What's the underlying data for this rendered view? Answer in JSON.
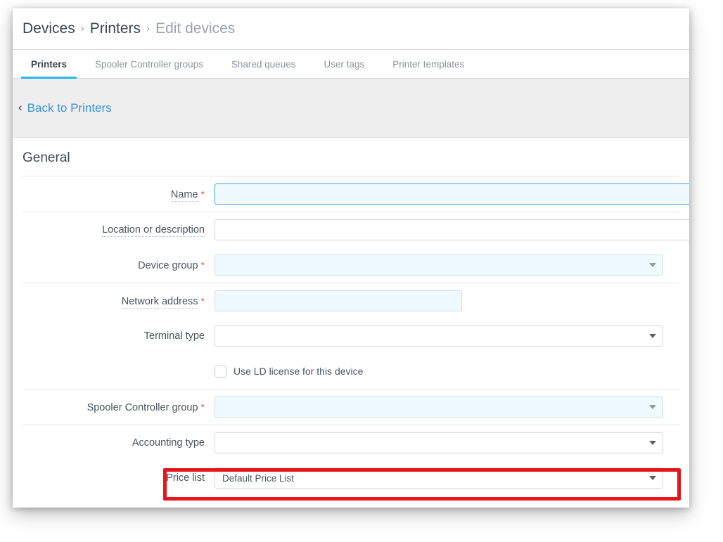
{
  "breadcrumb": {
    "items": [
      {
        "label": "Devices",
        "current": false
      },
      {
        "label": "Printers",
        "current": false
      },
      {
        "label": "Edit devices",
        "current": true
      }
    ],
    "separator": "›"
  },
  "tabs": [
    {
      "label": "Printers",
      "active": true
    },
    {
      "label": "Spooler Controller groups",
      "active": false
    },
    {
      "label": "Shared queues",
      "active": false
    },
    {
      "label": "User tags",
      "active": false
    },
    {
      "label": "Printer templates",
      "active": false
    }
  ],
  "back_link": {
    "label": "Back to Printers",
    "icon": "chevron-left-icon",
    "chevron": "‹"
  },
  "section": {
    "title": "General"
  },
  "fields": {
    "name": {
      "label": "Name",
      "required": true,
      "required_mark": "*",
      "value": "",
      "placeholder": ""
    },
    "location": {
      "label": "Location or description",
      "required": false,
      "value": "",
      "placeholder": ""
    },
    "device_group": {
      "label": "Device group",
      "required": true,
      "required_mark": "*",
      "value": ""
    },
    "network_address": {
      "label": "Network address",
      "required": true,
      "required_mark": "*",
      "value": "",
      "placeholder": ""
    },
    "terminal_type": {
      "label": "Terminal type",
      "required": false,
      "value": ""
    },
    "ld_license": {
      "label": "Use LD license for this device",
      "checked": false
    },
    "spooler_controller_group": {
      "label": "Spooler Controller group",
      "required": true,
      "required_mark": "*",
      "value": ""
    },
    "accounting_type": {
      "label": "Accounting type",
      "required": false,
      "value": ""
    },
    "price_list": {
      "label": "Price list",
      "required": false,
      "value": "Default Price List"
    }
  },
  "colors": {
    "accent": "#29b6e8",
    "link": "#3b93d6",
    "required": "#f05a4f",
    "annotation": "#e4161c",
    "field_blue": "#effaff",
    "band": "#eeeeee"
  }
}
